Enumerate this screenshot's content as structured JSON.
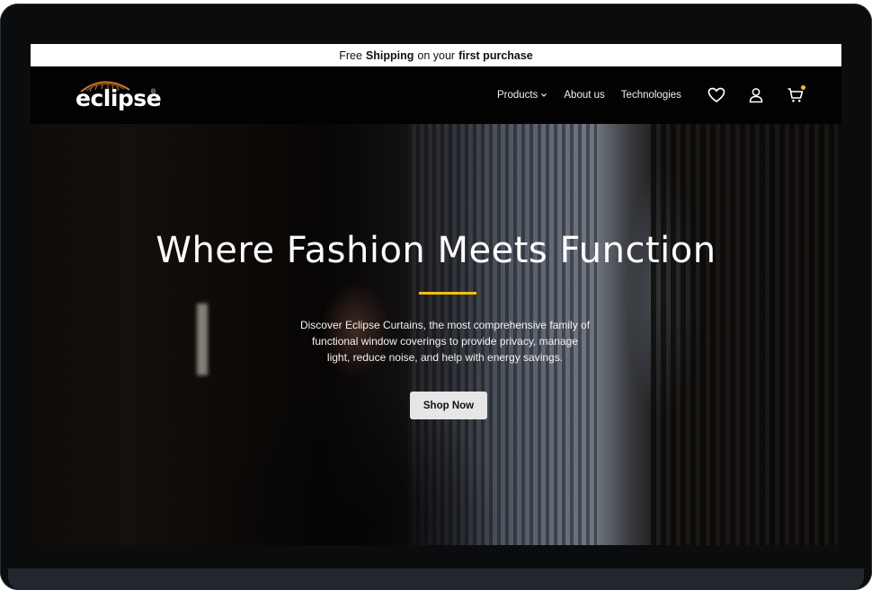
{
  "announcement": {
    "prefix": "Free",
    "bold1": "Shipping",
    "middle": "on your",
    "bold2": "first purchase"
  },
  "brand": {
    "name": "eclipse",
    "registered": "®"
  },
  "nav": {
    "items": [
      {
        "label": "Products",
        "has_dropdown": true
      },
      {
        "label": "About us"
      },
      {
        "label": "Technologies"
      }
    ]
  },
  "header_icons": [
    "heart-icon",
    "user-icon",
    "cart-icon"
  ],
  "hero": {
    "title": "Where Fashion Meets Function",
    "description_lines": [
      "Discover Eclipse Curtains, the most comprehensive family of",
      "functional window coverings to provide privacy, manage",
      "light, reduce noise, and help with energy savings."
    ],
    "cta_label": "Shop Now"
  },
  "colors": {
    "accent": "#f2c200",
    "background": "#020202",
    "announcement_bg": "#ffffff",
    "button_bg": "#e6e6e6"
  }
}
